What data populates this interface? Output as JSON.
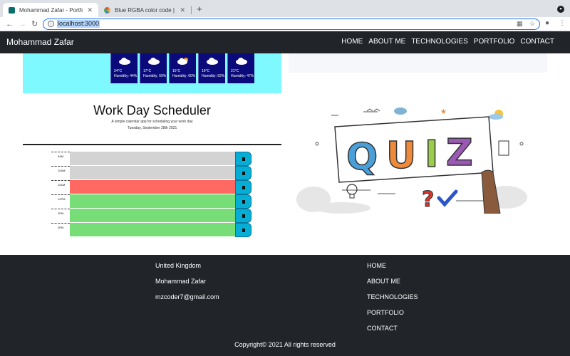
{
  "browser": {
    "tabs": [
      {
        "title": "Mohammad Zafar - Portfolio",
        "active": true,
        "favicon_color": "#0b6e6e"
      },
      {
        "title": "Blue RGBA color code | flatuicolo",
        "active": false,
        "favicon_color": "#e8453c"
      }
    ],
    "url": "localhost:3000",
    "accent": "#1a73e8"
  },
  "navbar": {
    "brand": "Mohammad Zafar",
    "links": [
      "HOME",
      "ABOUT ME",
      "TECHNOLOGIES",
      "PORTFOLIO",
      "CONTACT"
    ]
  },
  "weather": {
    "days": [
      {
        "temp": "24°C",
        "humidity": "Humidity: 44%",
        "icon": "cloud-icon"
      },
      {
        "temp": "17°C",
        "humidity": "Humidity: 59%",
        "icon": "cloud-icon"
      },
      {
        "temp": "15°C",
        "humidity": "Humidity: 60%",
        "icon": "sun-cloud-icon"
      },
      {
        "temp": "19°C",
        "humidity": "Humidity: 62%",
        "icon": "cloud-icon"
      },
      {
        "temp": "21°C",
        "humidity": "Humidity: 47%",
        "icon": "cloud-icon"
      }
    ]
  },
  "scheduler": {
    "title": "Work Day Scheduler",
    "subtitle": "A simple calendar app for scheduling your work day",
    "date": "Tuesday, September 28th 2021",
    "hours": [
      {
        "label": "9AM",
        "state": "past"
      },
      {
        "label": "10AM",
        "state": "past"
      },
      {
        "label": "11AM",
        "state": "present"
      },
      {
        "label": "12PM",
        "state": "future"
      },
      {
        "label": "1PM",
        "state": "future"
      },
      {
        "label": "2PM",
        "state": "future"
      }
    ]
  },
  "quiz": {
    "letters": [
      "Q",
      "U",
      "I",
      "Z"
    ],
    "letter_colors": [
      "#4a9fd8",
      "#ee8a3c",
      "#9acd4c",
      "#9b59b6"
    ]
  },
  "footer": {
    "location": "United Kingdom",
    "name": "Mohammad Zafar",
    "email": "mzcoder7@gmail.com",
    "links": [
      "HOME",
      "ABOUT ME",
      "TECHNOLOGIES",
      "PORTFOLIO",
      "CONTACT"
    ],
    "copyright": "Copyright© 2021 All rights reserved"
  }
}
